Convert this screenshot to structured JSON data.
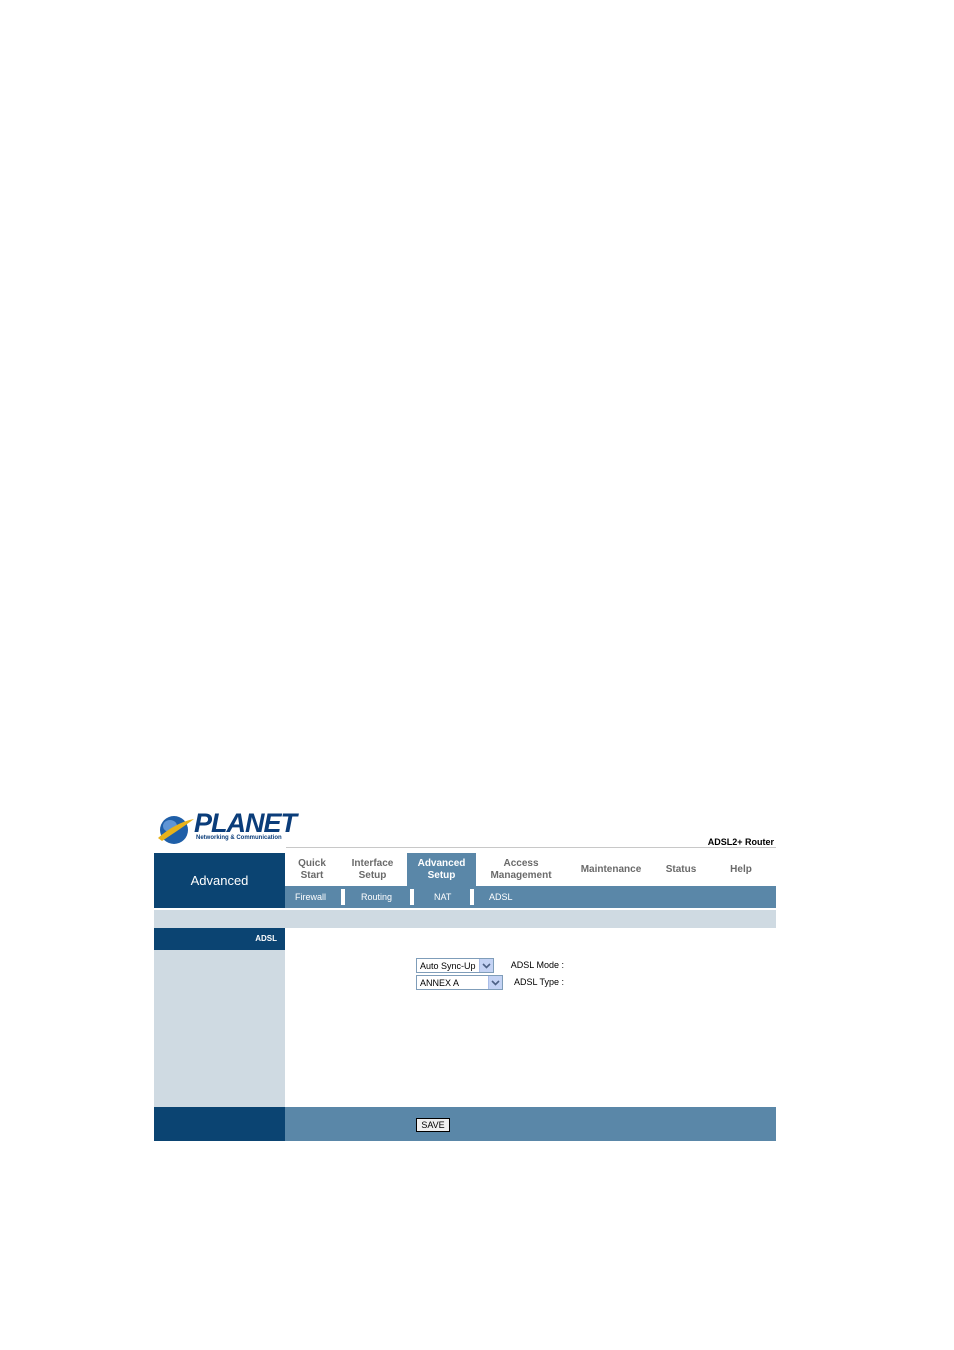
{
  "brand": {
    "logo_name": "PLANET",
    "logo_tagline": "Networking & Communication",
    "product": "ADSL2+ Router",
    "colors": {
      "navy": "#0b4472",
      "steel_blue": "#5a87a8",
      "light_gray_blue": "#cfdae2"
    }
  },
  "section": {
    "title": "Advanced"
  },
  "nav": {
    "items": [
      {
        "label": "Quick\nStart",
        "active": false
      },
      {
        "label": "Interface\nSetup",
        "active": false
      },
      {
        "label": "Advanced\nSetup",
        "active": true
      },
      {
        "label": "Access\nManagement",
        "active": false
      },
      {
        "label": "Maintenance",
        "active": false
      },
      {
        "label": "Status",
        "active": false
      },
      {
        "label": "Help",
        "active": false
      }
    ],
    "sub_items": [
      "Firewall",
      "Routing",
      "NAT",
      "ADSL"
    ]
  },
  "panel": {
    "label": "ADSL"
  },
  "form": {
    "adsl_mode_label": "ADSL Mode :",
    "adsl_mode_value": "Auto Sync-Up",
    "adsl_type_label": "ADSL Type :",
    "adsl_type_value": "ANNEX A",
    "dropdown_icon": "chevron-down-icon"
  },
  "footer": {
    "save_label": "SAVE"
  }
}
